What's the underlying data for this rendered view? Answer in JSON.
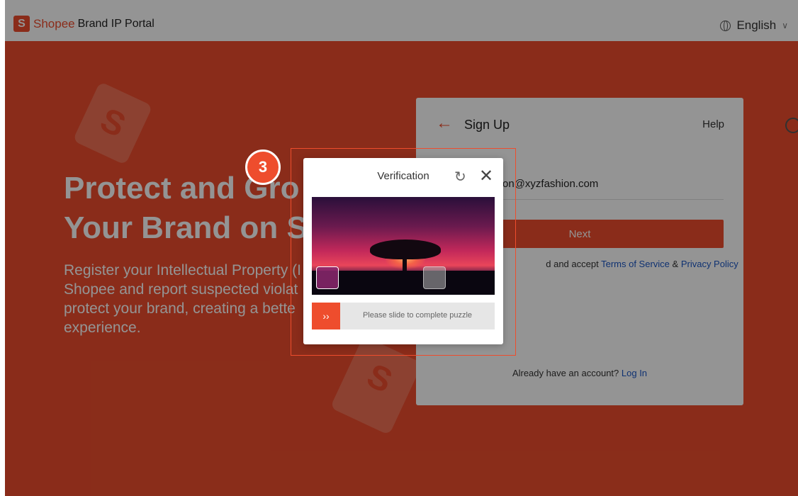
{
  "header": {
    "brand": "Shopee",
    "portal_name": "Brand IP Portal",
    "language": "English",
    "icons": {
      "logo": "shopee-bag-icon",
      "language": "globe-icon",
      "dropdown": "chevron-down-icon"
    }
  },
  "hero": {
    "headline_line1": "Protect and Gro",
    "headline_line2": "Your Brand on S",
    "subtext": "Register your Intellectual Property (I Shopee and report suspected violat protect your brand, creating a bette experience."
  },
  "signup": {
    "title": "Sign Up",
    "help": "Help",
    "email_value": "on@xyzfashion.com",
    "next_label": "Next",
    "terms_prefix": "d and accept",
    "terms_link": "Terms of Service",
    "terms_and": "&",
    "privacy_link": "Privacy Policy",
    "login_prompt": "Already have an account?",
    "login_link": "Log In"
  },
  "verification": {
    "title": "Verification",
    "slider_hint": "Please slide to complete puzzle",
    "slider_arrow": "››"
  },
  "annotation": {
    "step": "3"
  },
  "colors": {
    "brand": "#ee4d2d",
    "link": "#1b56c4"
  }
}
